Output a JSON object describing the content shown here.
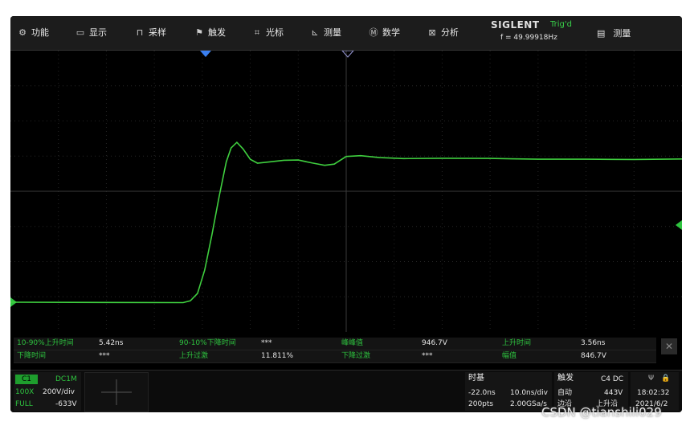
{
  "menu": [
    {
      "icon": "gear-icon",
      "glyph": "⚙",
      "label": "功能"
    },
    {
      "icon": "display-icon",
      "glyph": "▭",
      "label": "显示"
    },
    {
      "icon": "acquire-icon",
      "glyph": "⊓",
      "label": "采样"
    },
    {
      "icon": "trigger-icon",
      "glyph": "⚑",
      "label": "触发"
    },
    {
      "icon": "cursor-icon",
      "glyph": "⌗",
      "label": "光标"
    },
    {
      "icon": "measure-icon",
      "glyph": "⊾",
      "label": "测量"
    },
    {
      "icon": "math-icon",
      "glyph": "Ⓜ",
      "label": "数学"
    },
    {
      "icon": "analysis-icon",
      "glyph": "⊠",
      "label": "分析"
    }
  ],
  "brand": {
    "name": "SIGLENT",
    "trig_status": "Trig'd",
    "frequency": "f = 49.99918Hz"
  },
  "measure_button": {
    "icon": "list-icon",
    "label": "测量"
  },
  "measurements": {
    "row1": [
      {
        "label": "10-90%上升时间",
        "value": "5.42ns"
      },
      {
        "label": "90-10%下降时间",
        "value": "***"
      },
      {
        "label": "峰峰值",
        "value": "946.7V"
      },
      {
        "label": "上升时间",
        "value": "3.56ns"
      }
    ],
    "row2": [
      {
        "label": "下降时间",
        "value": "***"
      },
      {
        "label": "上升过激",
        "value": "11.811%"
      },
      {
        "label": "下降过激",
        "value": "***"
      },
      {
        "label": "幅值",
        "value": "846.7V"
      }
    ]
  },
  "channel": {
    "tag": "C1",
    "coupling": "DC1M",
    "probe": "100X",
    "scale": "200V/div",
    "bandwidth": "FULL",
    "offset": "-633V"
  },
  "timebase": {
    "title": "时基",
    "delay": "-22.0ns",
    "scale": "10.0ns/div",
    "points": "200pts",
    "sample_rate": "2.00GSa/s"
  },
  "trigger": {
    "title": "触发",
    "source": "C4 DC",
    "mode": "自动",
    "level": "443V",
    "type_label": "边沿",
    "slope": "上升沿"
  },
  "status": {
    "time": "18:02:32",
    "date": "2021/6/2"
  },
  "watermark": "CSDN @tianshili029",
  "colors": {
    "trace": "#3fcf3f",
    "label_green": "#2ec43f",
    "background": "#000000"
  },
  "waveform": {
    "description_units": "divisions",
    "points": [
      [
        0,
        0.0
      ],
      [
        3.6,
        0.0
      ],
      [
        3.75,
        0.05
      ],
      [
        3.9,
        0.25
      ],
      [
        4.05,
        0.9
      ],
      [
        4.2,
        1.9
      ],
      [
        4.35,
        3.0
      ],
      [
        4.5,
        4.0
      ],
      [
        4.6,
        4.4
      ],
      [
        4.72,
        4.55
      ],
      [
        4.85,
        4.35
      ],
      [
        5.0,
        4.05
      ],
      [
        5.15,
        3.95
      ],
      [
        5.4,
        4.0
      ],
      [
        5.7,
        4.05
      ],
      [
        6.0,
        4.05
      ],
      [
        6.3,
        3.95
      ],
      [
        6.55,
        3.88
      ],
      [
        6.75,
        3.92
      ],
      [
        7.0,
        4.15
      ],
      [
        7.3,
        4.18
      ],
      [
        7.7,
        4.12
      ],
      [
        8.2,
        4.08
      ],
      [
        9.0,
        4.08
      ],
      [
        10.0,
        4.08
      ],
      [
        11.0,
        4.07
      ],
      [
        12.0,
        4.08
      ],
      [
        13.0,
        4.07
      ],
      [
        14.0,
        4.07
      ]
    ]
  }
}
